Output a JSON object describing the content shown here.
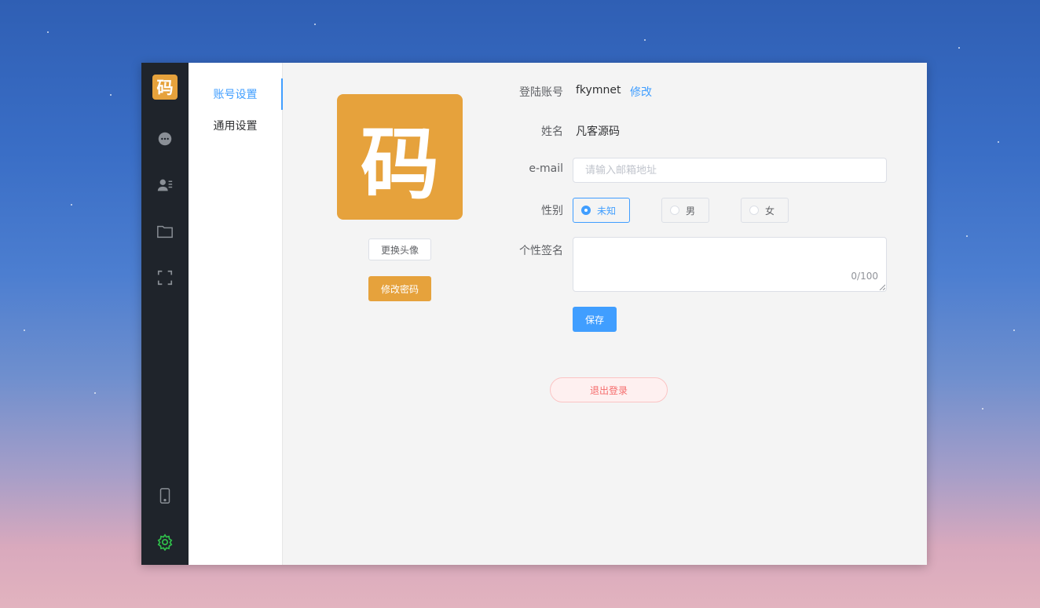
{
  "rail": {
    "logo_text": "码",
    "accent_active": "#30c24b"
  },
  "submenu": {
    "items": [
      {
        "label": "账号设置",
        "active": true
      },
      {
        "label": "通用设置",
        "active": false
      }
    ]
  },
  "avatar": {
    "text": "码",
    "bg": "#e6a23c",
    "change_label": "更换头像",
    "password_label": "修改密码"
  },
  "form": {
    "account_label": "登陆账号",
    "account_value": "fkymnet",
    "account_edit": "修改",
    "name_label": "姓名",
    "name_value": "凡客源码",
    "email_label": "e-mail",
    "email_placeholder": "请输入邮箱地址",
    "email_value": "",
    "gender_label": "性别",
    "gender_options": [
      "未知",
      "男",
      "女"
    ],
    "gender_selected": "未知",
    "signature_label": "个性签名",
    "signature_value": "",
    "signature_counter": "0/100",
    "save_label": "保存",
    "logout_label": "退出登录"
  }
}
